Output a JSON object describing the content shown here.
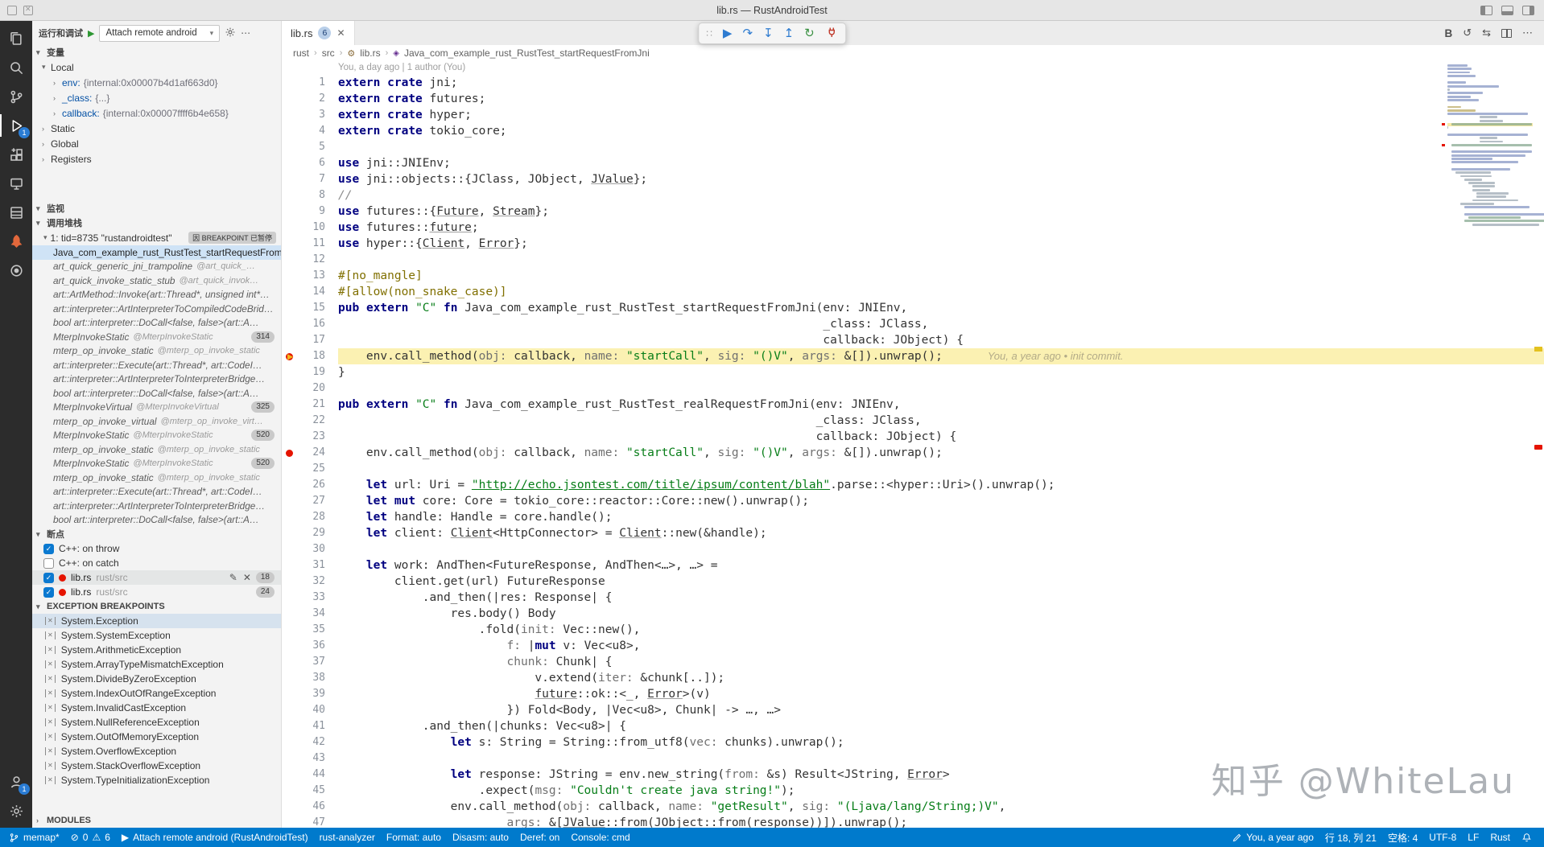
{
  "colors": {
    "accent": "#007acc",
    "statusbar": "#007acc",
    "highlight_line": "#fbf1b2",
    "breakpoint_red": "#e51400",
    "current_arrow": "#f5b51d"
  },
  "icons": {
    "chevron_down": "▾",
    "chevron_right": "›",
    "play": "▶",
    "gear": "⚙",
    "more": "⋯",
    "close": "✕",
    "edit": "✎",
    "error": "⊘",
    "warning": "⚠",
    "continue": "▶",
    "step_over": "↷",
    "step_into": "↧",
    "step_out": "↥",
    "restart": "↻",
    "grip": "∷",
    "history": "↺",
    "compare": "⇆",
    "blame_toggle": "B"
  },
  "title_bar": {
    "title": "lib.rs — RustAndroidTest"
  },
  "activity_bar": {
    "items": [
      {
        "name": "explorer",
        "icon": "files"
      },
      {
        "name": "search",
        "icon": "search"
      },
      {
        "name": "source-control",
        "icon": "scm"
      },
      {
        "name": "run-and-debug",
        "icon": "debug",
        "active": true,
        "badge": "1"
      },
      {
        "name": "extensions",
        "icon": "extensions"
      },
      {
        "name": "remote-explorer",
        "icon": "remote"
      },
      {
        "name": "containers",
        "icon": "storage"
      },
      {
        "name": "rocket-plugin",
        "icon": "rocket"
      },
      {
        "name": "test-target",
        "icon": "target"
      }
    ],
    "bottom": [
      {
        "name": "account",
        "icon": "account",
        "badge": "1"
      },
      {
        "name": "settings",
        "icon": "gear"
      }
    ]
  },
  "sidebar": {
    "header": {
      "title": "运行和调试",
      "config": "Attach remote android"
    },
    "variables": {
      "title": "变量",
      "scopes": [
        {
          "label": "Local",
          "expanded": true,
          "children": [
            {
              "name": "env",
              "value": "{internal:0x00007b4d1af663d0}"
            },
            {
              "name": "_class",
              "value": "{...}"
            },
            {
              "name": "callback",
              "value": "{internal:0x00007ffff6b4e658}"
            }
          ]
        },
        {
          "label": "Static"
        },
        {
          "label": "Global"
        },
        {
          "label": "Registers"
        }
      ]
    },
    "watch": {
      "title": "监视"
    },
    "call_stack": {
      "title": "调用堆栈",
      "thread": "1: tid=8735 \"rustandroidtest\"",
      "thread_badge": "因 BREAKPOINT 已暂停",
      "frames": [
        {
          "label": "Java_com_example_rust_RustTest_startRequestFromJni",
          "selected": true
        },
        {
          "label": "art_quick_generic_jni_trampoline",
          "detail": "@art_quick_…"
        },
        {
          "label": "art_quick_invoke_static_stub",
          "detail": "@art_quick_invok…"
        },
        {
          "label": "art::ArtMethod::Invoke(art::Thread*, unsigned int*…"
        },
        {
          "label": "art::interpreter::ArtInterpreterToCompiledCodeBrid…"
        },
        {
          "label": "bool art::interpreter::DoCall<false, false>(art::A…"
        },
        {
          "label": "MterpInvokeStatic",
          "detail": "@MterpInvokeStatic",
          "badge": "314"
        },
        {
          "label": "mterp_op_invoke_static",
          "detail": "@mterp_op_invoke_static"
        },
        {
          "label": "art::interpreter::Execute(art::Thread*, art::CodeI…"
        },
        {
          "label": "art::interpreter::ArtInterpreterToInterpreterBridge…"
        },
        {
          "label": "bool art::interpreter::DoCall<false, false>(art::A…"
        },
        {
          "label": "MterpInvokeVirtual",
          "detail": "@MterpInvokeVirtual",
          "badge": "325"
        },
        {
          "label": "mterp_op_invoke_virtual",
          "detail": "@mterp_op_invoke_virt…"
        },
        {
          "label": "MterpInvokeStatic",
          "detail": "@MterpInvokeStatic",
          "badge": "520"
        },
        {
          "label": "mterp_op_invoke_static",
          "detail": "@mterp_op_invoke_static"
        },
        {
          "label": "MterpInvokeStatic",
          "detail": "@MterpInvokeStatic",
          "badge": "520"
        },
        {
          "label": "mterp_op_invoke_static",
          "detail": "@mterp_op_invoke_static"
        },
        {
          "label": "art::interpreter::Execute(art::Thread*, art::CodeI…"
        },
        {
          "label": "art::interpreter::ArtInterpreterToInterpreterBridge…"
        },
        {
          "label": "bool art::interpreter::DoCall<false, false>(art::A…"
        }
      ]
    },
    "breakpoints": {
      "title": "断点",
      "exceptions": [
        {
          "label": "C++: on throw",
          "checked": true
        },
        {
          "label": "C++: on catch",
          "checked": false
        }
      ],
      "files": [
        {
          "file": "lib.rs",
          "path": "rust/src",
          "line": "18",
          "checked": true,
          "hover": true
        },
        {
          "file": "lib.rs",
          "path": "rust/src",
          "line": "24",
          "checked": true
        }
      ]
    },
    "exception_breakpoints": {
      "title": "EXCEPTION BREAKPOINTS",
      "items": [
        "System.Exception",
        "System.SystemException",
        "System.ArithmeticException",
        "System.ArrayTypeMismatchException",
        "System.DivideByZeroException",
        "System.IndexOutOfRangeException",
        "System.InvalidCastException",
        "System.NullReferenceException",
        "System.OutOfMemoryException",
        "System.OverflowException",
        "System.StackOverflowException",
        "System.TypeInitializationException"
      ]
    },
    "modules": {
      "title": "MODULES"
    }
  },
  "editor": {
    "tab": {
      "label": "lib.rs",
      "badge": "6"
    },
    "breadcrumb": [
      "rust",
      "src",
      "lib.rs",
      "Java_com_example_rust_RustTest_startRequestFromJni"
    ],
    "file_blame": "You, a day ago | 1 author (You)",
    "current_line": 18,
    "current_line_blame": "You, a year ago • init commit.",
    "breakpoints": [
      18,
      24
    ],
    "code": [
      "extern crate jni;",
      "extern crate futures;",
      "extern crate hyper;",
      "extern crate tokio_core;",
      "",
      "use jni::JNIEnv;",
      "use jni::objects::{JClass, JObject, JValue};",
      "//",
      "use futures::{Future, Stream};",
      "use futures::future;",
      "use hyper::{Client, Error};",
      "",
      "#[no_mangle]",
      "#[allow(non_snake_case)]",
      "pub extern \"C\" fn Java_com_example_rust_RustTest_startRequestFromJni(env: JNIEnv,",
      "                                                                     _class: JClass,",
      "                                                                     callback: JObject) {",
      "    env.call_method(obj: callback, name: \"startCall\", sig: \"()V\", args: &[]).unwrap();",
      "}",
      "",
      "pub extern \"C\" fn Java_com_example_rust_RustTest_realRequestFromJni(env: JNIEnv,",
      "                                                                    _class: JClass,",
      "                                                                    callback: JObject) {",
      "    env.call_method(obj: callback, name: \"startCall\", sig: \"()V\", args: &[]).unwrap();",
      "",
      "    let url: Uri = \"http://echo.jsontest.com/title/ipsum/content/blah\".parse::<hyper::Uri>().unwrap();",
      "    let mut core: Core = tokio_core::reactor::Core::new().unwrap();",
      "    let handle: Handle = core.handle();",
      "    let client: Client<HttpConnector> = Client::new(&handle);",
      "",
      "    let work: AndThen<FutureResponse, AndThen<…>, …> =",
      "        client.get(url) FutureResponse",
      "            .and_then(|res: Response| {",
      "                res.body() Body",
      "                    .fold(init: Vec::new(),",
      "                        f: |mut v: Vec<u8>,",
      "                        chunk: Chunk| {",
      "                            v.extend(iter: &chunk[..]);",
      "                            future::ok::<_, Error>(v)",
      "                        }) Fold<Body, |Vec<u8>, Chunk| -> …, …>",
      "            .and_then(|chunks: Vec<u8>| {",
      "                let s: String = String::from_utf8(vec: chunks).unwrap();",
      "",
      "                let response: JString = env.new_string(from: &s) Result<JString, Error>",
      "                    .expect(msg: \"Couldn't create java string!\");",
      "                env.call_method(obj: callback, name: \"getResult\", sig: \"(Ljava/lang/String;)V\",",
      "                        args: &[JValue::from(JObject::from(response))]).unwrap();"
    ]
  },
  "status_bar": {
    "branch": "memap*",
    "errors": "0",
    "warnings": "6",
    "debug_target": "Attach remote android (RustAndroidTest)",
    "analyzer": "rust-analyzer",
    "format": "Format: auto",
    "disasm": "Disasm: auto",
    "deref": "Deref: on",
    "console": "Console: cmd",
    "blame": "You, a year ago",
    "cursor": "行 18, 列 21",
    "indent": "空格: 4",
    "encoding": "UTF-8",
    "eol": "LF",
    "language": "Rust"
  },
  "watermark": "知乎 @WhiteLau"
}
